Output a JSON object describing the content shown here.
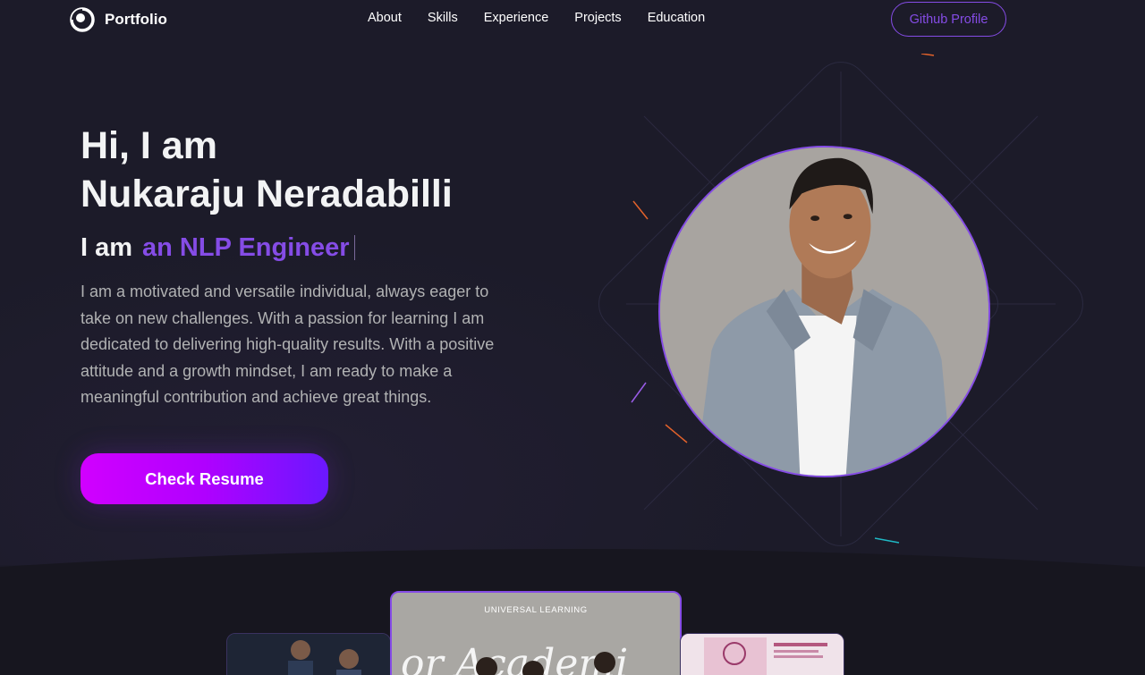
{
  "nav": {
    "logo_text": "Portfolio",
    "links": [
      "About",
      "Skills",
      "Experience",
      "Projects",
      "Education"
    ],
    "github_label": "Github Profile"
  },
  "hero": {
    "greeting": "Hi, I am",
    "name": "Nukaraju Neradabilli",
    "role_prefix": "I am",
    "role": "an NLP Engineer",
    "bio": "I am a motivated and versatile individual, always eager to take on new challenges. With a passion for learning I am dedicated to delivering high-quality results. With a positive attitude and a growth mindset, I am ready to make a meaningful contribution and achieve great things.",
    "resume_label": "Check Resume"
  },
  "gallery": {
    "center_caption": "UNIVERSAL LEARNING"
  },
  "colors": {
    "background": "#1c1b29",
    "accent": "#854ce6",
    "text_primary": "#f2f3f4",
    "text_secondary": "#b1b2b3",
    "button_gradient_start": "#d100ff",
    "button_gradient_end": "#6a18ff"
  },
  "icons": {
    "logo": "portfolio-logo-icon"
  }
}
